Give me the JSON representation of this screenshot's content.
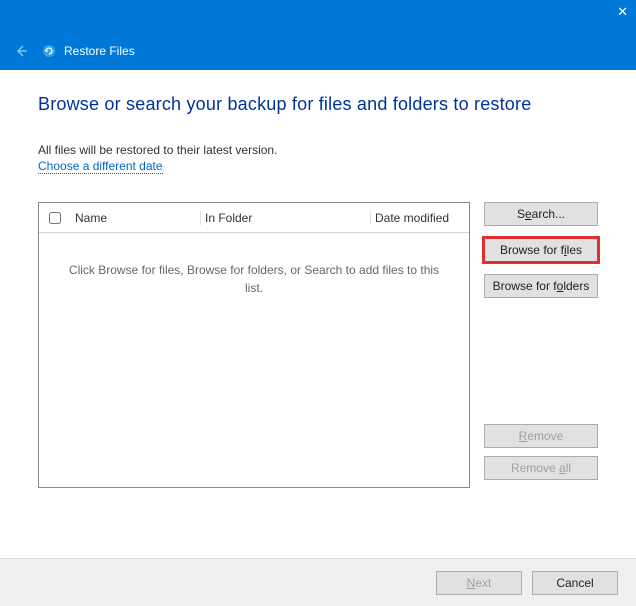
{
  "window": {
    "app_name": "Restore Files",
    "close_glyph": "✕"
  },
  "page": {
    "title": "Browse or search your backup for files and folders to restore",
    "info_line": "All files will be restored to their latest version.",
    "choose_date_link": "Choose a different date"
  },
  "list": {
    "col_name": "Name",
    "col_folder": "In Folder",
    "col_date": "Date modified",
    "empty_text": "Click Browse for files, Browse for folders, or Search to add files to this list."
  },
  "buttons": {
    "search_pre": "S",
    "search_u": "e",
    "search_post": "arch...",
    "browse_files_pre": "Browse for f",
    "browse_files_u": "i",
    "browse_files_post": "les",
    "browse_folders_pre": "Browse for f",
    "browse_folders_u": "o",
    "browse_folders_post": "lders",
    "remove_pre": "",
    "remove_u": "R",
    "remove_post": "emove",
    "remove_all_pre": "Remove ",
    "remove_all_u": "a",
    "remove_all_post": "ll",
    "next_pre": "",
    "next_u": "N",
    "next_post": "ext",
    "cancel": "Cancel"
  }
}
